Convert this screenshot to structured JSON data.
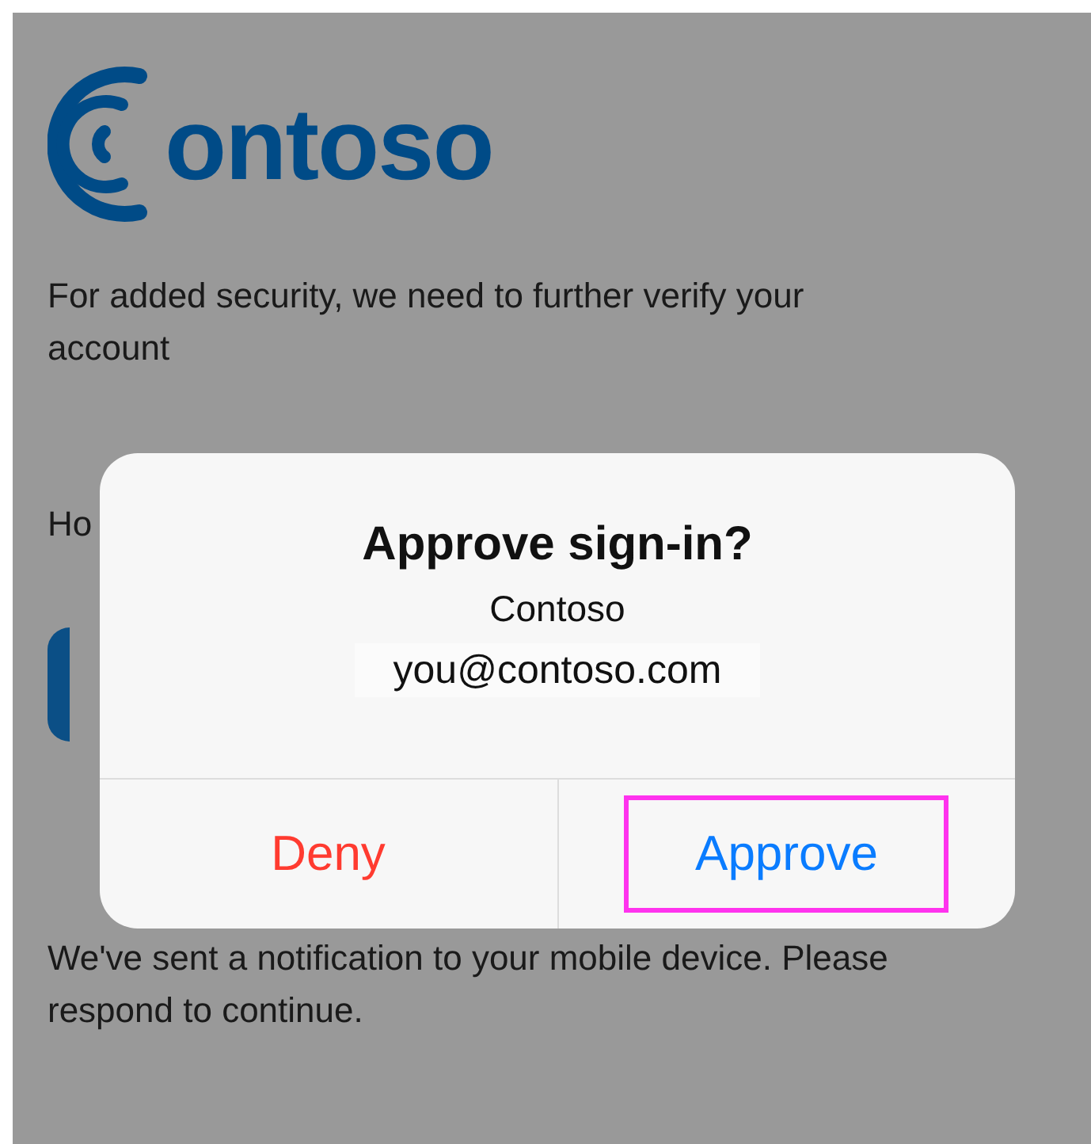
{
  "logo": {
    "text": "ontoso"
  },
  "intro": "For added security, we need to further verify your account",
  "partial_label": "Ho",
  "dialog": {
    "title": "Approve sign-in?",
    "org": "Contoso",
    "account": "you@contoso.com",
    "buttons": [
      {
        "label": "Deny",
        "kind": "destructive",
        "highlighted": false
      },
      {
        "label": "Approve",
        "kind": "default",
        "highlighted": true
      }
    ]
  },
  "footer": "We've sent a notification to your mobile device. Please respond to continue."
}
